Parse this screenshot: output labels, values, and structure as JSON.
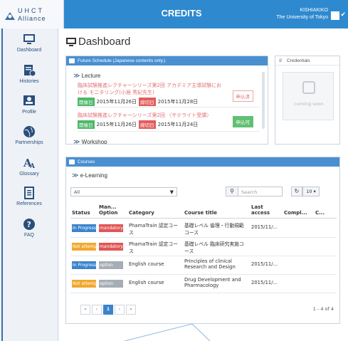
{
  "brand": {
    "line1": "UHCT",
    "line2": "Alliance"
  },
  "header": {
    "title": "CREDITS",
    "user_name": "KISHIAKIKO",
    "user_org": "The University of Tokyo",
    "accent": "#2e89cf"
  },
  "sidebar": {
    "items": [
      {
        "label": "Dashboard",
        "icon": "monitor-icon"
      },
      {
        "label": "Histories",
        "icon": "history-icon"
      },
      {
        "label": "Profile",
        "icon": "profile-card-icon"
      },
      {
        "label": "Partnerships",
        "icon": "globe-icon"
      },
      {
        "label": "Glossary",
        "icon": "glossary-icon"
      },
      {
        "label": "References",
        "icon": "document-icon"
      },
      {
        "label": "FAQ",
        "icon": "question-icon"
      }
    ]
  },
  "page": {
    "title": "Dashboard"
  },
  "schedule": {
    "title": "Future Schedule (Japanese contents only.)",
    "section_lecture": "Lecture",
    "section_workshop": "Workshop",
    "lectures": [
      {
        "title": "臨床試験推進レクチャーシリーズ第2回 アカデミア主導試験における モニタリング(小居 秀紀先生)",
        "open_tag": "開催日",
        "open_date": "2015年11月26日",
        "close_tag": "締切日",
        "close_date": "2015年11月28日",
        "action": "申込済"
      },
      {
        "title": "臨床試験推進レクチャーシリーズ第2回 〈サテライト受講〉",
        "open_tag": "開催日",
        "open_date": "2015年11月26日",
        "close_tag": "締切日",
        "close_date": "2015年11月24日",
        "action": "申込可"
      }
    ]
  },
  "credentials": {
    "title": "Credentials",
    "placeholder": "coming soon"
  },
  "courses": {
    "title": "Courses",
    "section": "e-Learning",
    "filter_value": "All",
    "search_placeholder": "Search",
    "page_size": "10",
    "columns": [
      "Status",
      "Man... Option",
      "Category",
      "Course title",
      "Last access",
      "Compl...",
      "C..."
    ],
    "rows": [
      {
        "status": "In Progress",
        "status_color": "#3b84cc",
        "option": "mandatory",
        "option_color": "#e05656",
        "category": "PhamaTrain 認定コース",
        "course": "基礎レベル 倫理・行動規範コース",
        "last": "2015/11/...",
        "compl": "",
        "c": ""
      },
      {
        "status": "Not attempted",
        "status_color": "#f0a830",
        "option": "mandatory",
        "option_color": "#e05656",
        "category": "PhamaTrain 認定コース",
        "course": "基礎レベル 臨床研究実施コース",
        "last": "",
        "compl": "",
        "c": ""
      },
      {
        "status": "In Progress",
        "status_color": "#3b84cc",
        "option": "option",
        "option_color": "#a6adb6",
        "category": "English course",
        "course": "Principles of clinical Research and Design",
        "last": "2015/11/...",
        "compl": "",
        "c": ""
      },
      {
        "status": "Not attempted",
        "status_color": "#f0a830",
        "option": "option",
        "option_color": "#a6adb6",
        "category": "English course",
        "course": "Drug Development and Pharmacology",
        "last": "2015/11/...",
        "compl": "",
        "c": ""
      }
    ],
    "pager": {
      "first": "«",
      "prev": "‹",
      "current": "1",
      "next": "›",
      "last": "»",
      "info": "1 - 4 of 4"
    }
  }
}
